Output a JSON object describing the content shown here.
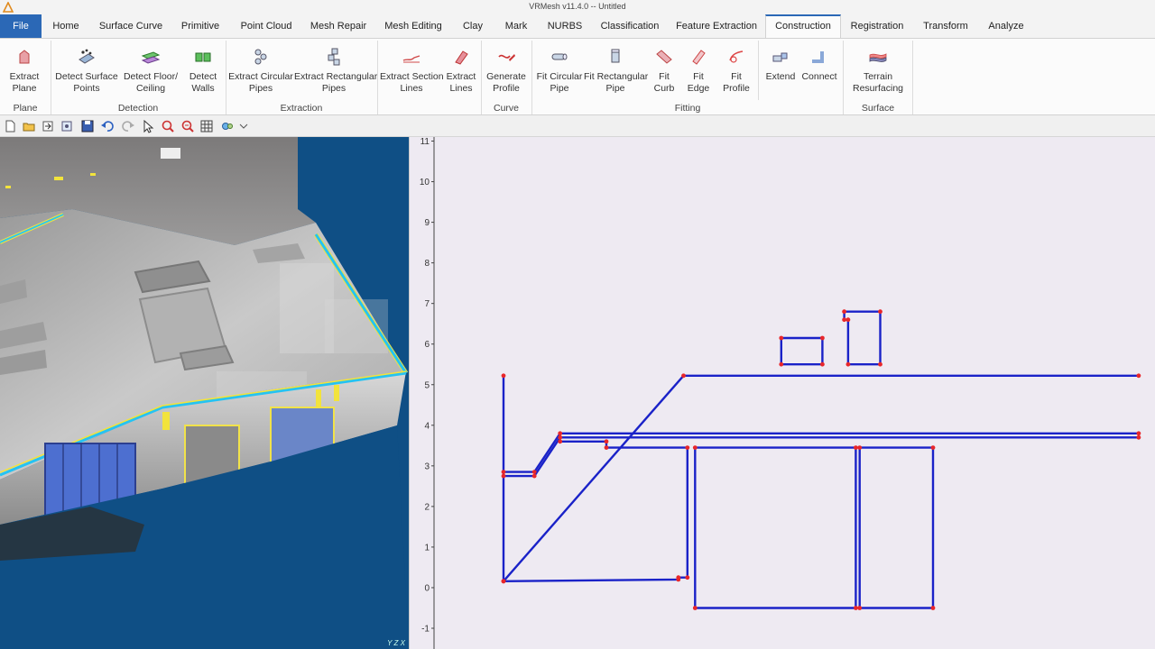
{
  "window": {
    "title": "VRMesh v11.4.0 -- Untitled"
  },
  "menu": {
    "tabs": [
      {
        "label": "File"
      },
      {
        "label": "Home"
      },
      {
        "label": "Surface Curve"
      },
      {
        "label": "Primitive"
      },
      {
        "label": "Point Cloud"
      },
      {
        "label": "Mesh Repair"
      },
      {
        "label": "Mesh Editing"
      },
      {
        "label": "Clay"
      },
      {
        "label": "Mark"
      },
      {
        "label": "NURBS"
      },
      {
        "label": "Classification"
      },
      {
        "label": "Feature Extraction"
      },
      {
        "label": "Construction"
      },
      {
        "label": "Registration"
      },
      {
        "label": "Transform"
      },
      {
        "label": "Analyze"
      }
    ],
    "active": "Construction"
  },
  "ribbon": {
    "buttons": [
      {
        "line1": "Extract",
        "line2": "Plane",
        "icon": "extract-plane-icon"
      },
      {
        "line1": "Detect Surface",
        "line2": "Points",
        "icon": "detect-surface-points-icon"
      },
      {
        "line1": "Detect Floor/",
        "line2": "Ceiling",
        "icon": "detect-floor-ceiling-icon"
      },
      {
        "line1": "Detect",
        "line2": "Walls",
        "icon": "detect-walls-icon"
      },
      {
        "line1": "Extract Circular",
        "line2": "Pipes",
        "icon": "extract-circular-pipes-icon"
      },
      {
        "line1": "Extract Rectangular",
        "line2": "Pipes",
        "icon": "extract-rectangular-pipes-icon"
      },
      {
        "line1": "Extract Section",
        "line2": "Lines",
        "icon": "extract-section-lines-icon"
      },
      {
        "line1": "Extract",
        "line2": "Lines",
        "icon": "extract-lines-icon"
      },
      {
        "line1": "Generate",
        "line2": "Profile",
        "icon": "generate-profile-icon"
      },
      {
        "line1": "Fit Circular",
        "line2": "Pipe",
        "icon": "fit-circular-pipe-icon"
      },
      {
        "line1": "Fit Rectangular",
        "line2": "Pipe",
        "icon": "fit-rectangular-pipe-icon"
      },
      {
        "line1": "Fit",
        "line2": "Curb",
        "icon": "fit-curb-icon"
      },
      {
        "line1": "Fit",
        "line2": "Edge",
        "icon": "fit-edge-icon"
      },
      {
        "line1": "Fit",
        "line2": "Profile",
        "icon": "fit-profile-icon"
      },
      {
        "line1": "Extend",
        "line2": "",
        "icon": "extend-icon"
      },
      {
        "line1": "Connect",
        "line2": "",
        "icon": "connect-icon"
      },
      {
        "line1": "Terrain",
        "line2": "Resurfacing",
        "icon": "terrain-resurfacing-icon"
      }
    ],
    "groups": [
      {
        "label": "Plane"
      },
      {
        "label": "Detection"
      },
      {
        "label": "Extraction"
      },
      {
        "label": "Curve"
      },
      {
        "label": "Fitting"
      },
      {
        "label": "Surface"
      }
    ]
  },
  "quickbar": {
    "icons": [
      "new-file-icon",
      "open-folder-icon",
      "import-icon",
      "export-icon",
      "save-icon",
      "undo-icon",
      "redo-icon",
      "select-pointer-icon",
      "zoom-window-icon",
      "zoom-fit-icon",
      "grid-icon",
      "view-icon",
      "dropdown-arrow-icon"
    ]
  },
  "view3d": {
    "axis_label": "Y Z X"
  },
  "chart_data": {
    "type": "line",
    "title": "",
    "xlabel": "",
    "ylabel": "",
    "ylim": [
      -1,
      11
    ],
    "yticks": [
      "11",
      "10",
      "9",
      "8",
      "7",
      "6",
      "5",
      "4",
      "3",
      "2",
      "1",
      "0",
      "-1"
    ],
    "colors": {
      "line": "#1a22c8",
      "vertex": "#e8262a"
    },
    "grid": false,
    "series": [
      {
        "closed": false,
        "points": [
          [
            0,
            0.16
          ],
          [
            7.0,
            5.22
          ],
          [
            24.7,
            5.22
          ]
        ]
      },
      {
        "closed": false,
        "points": [
          [
            0,
            2.75
          ],
          [
            1.2,
            2.75
          ],
          [
            2.2,
            3.7
          ],
          [
            24.7,
            3.7
          ]
        ]
      },
      {
        "closed": false,
        "points": [
          [
            0,
            2.85
          ],
          [
            1.2,
            2.85
          ],
          [
            2.2,
            3.8
          ],
          [
            24.7,
            3.8
          ]
        ]
      },
      {
        "closed": false,
        "points": [
          [
            0,
            0.16
          ],
          [
            0,
            5.22
          ]
        ]
      },
      {
        "closed": false,
        "points": [
          [
            0,
            0.16
          ],
          [
            6.8,
            0.2
          ],
          [
            6.8,
            0.25
          ],
          [
            7.15,
            0.25
          ],
          [
            7.15,
            3.45
          ],
          [
            4.0,
            3.45
          ],
          [
            4.0,
            3.6
          ],
          [
            2.2,
            3.6
          ]
        ]
      },
      {
        "closed": true,
        "points": [
          [
            7.45,
            -0.5
          ],
          [
            13.7,
            -0.5
          ],
          [
            13.7,
            3.45
          ],
          [
            7.45,
            3.45
          ]
        ]
      },
      {
        "closed": true,
        "points": [
          [
            13.85,
            -0.5
          ],
          [
            16.7,
            -0.5
          ],
          [
            16.7,
            3.45
          ],
          [
            13.85,
            3.45
          ]
        ]
      },
      {
        "closed": true,
        "points": [
          [
            10.8,
            5.5
          ],
          [
            12.4,
            5.5
          ],
          [
            12.4,
            6.15
          ],
          [
            10.8,
            6.15
          ]
        ]
      },
      {
        "closed": true,
        "points": [
          [
            13.4,
            5.5
          ],
          [
            14.65,
            5.5
          ],
          [
            14.65,
            6.8
          ],
          [
            13.25,
            6.8
          ],
          [
            13.25,
            6.6
          ],
          [
            13.4,
            6.6
          ]
        ]
      }
    ]
  }
}
